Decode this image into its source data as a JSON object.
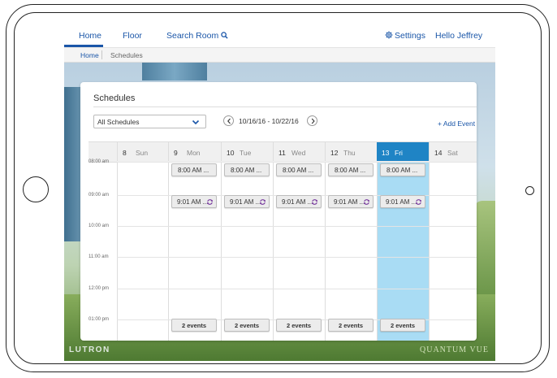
{
  "nav": {
    "home": "Home",
    "floor": "Floor",
    "search_room": "Search Room",
    "settings": "Settings",
    "greeting": "Hello Jeffrey"
  },
  "breadcrumb": {
    "home": "Home",
    "current": "Schedules"
  },
  "page": {
    "title": "Schedules",
    "filter_value": "All Schedules",
    "date_range": "10/16/16 - 10/22/16",
    "add_event": "+ Add Event"
  },
  "calendar": {
    "days": [
      {
        "num": "8",
        "name": "Sun"
      },
      {
        "num": "9",
        "name": "Mon"
      },
      {
        "num": "10",
        "name": "Tue"
      },
      {
        "num": "11",
        "name": "Wed"
      },
      {
        "num": "12",
        "name": "Thu"
      },
      {
        "num": "13",
        "name": "Fri"
      },
      {
        "num": "14",
        "name": "Sat"
      }
    ],
    "today_index": 5,
    "times": [
      "08:00 am",
      "09:00 am",
      "10:00 am",
      "11:00 am",
      "12:00 pm",
      "01:00 pm"
    ],
    "event_8am": "8:00 AM ...",
    "event_901am": "9:01 AM ...",
    "more_events": "2 events"
  },
  "footer": {
    "logo": "LUTRON",
    "brand": "QUANTUM VUE"
  },
  "colors": {
    "accent": "#1a56a8",
    "today_header": "#1f84c5",
    "today_column": "#a9dcf4",
    "recurring_icon": "#7b3fa0"
  }
}
